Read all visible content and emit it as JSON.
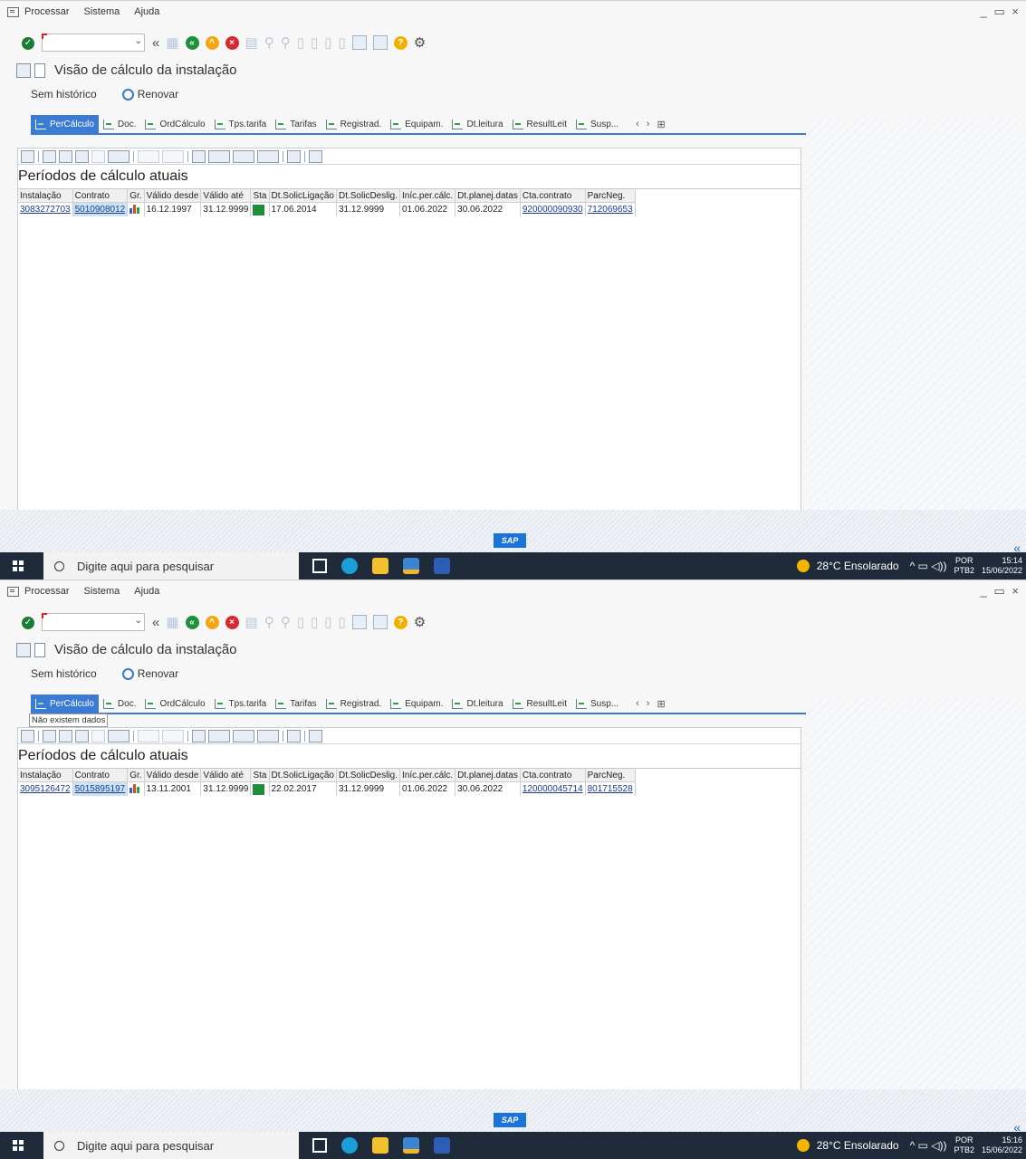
{
  "menu": {
    "processar": "Processar",
    "sistema": "Sistema",
    "ajuda": "Ajuda"
  },
  "window_controls": "_ ▭ ×",
  "title": "Visão de cálculo da instalação",
  "app_toolbar": {
    "sem_historico": "Sem histórico",
    "renovar": "Renovar"
  },
  "tabs": [
    "PerCálculo",
    "Doc.",
    "OrdCálculo",
    "Tps.tarifa",
    "Tarifas",
    "Registrad.",
    "Equipam.",
    "Dt.leitura",
    "ResultLeit",
    "Susp..."
  ],
  "tab_nav": {
    "prev": "‹",
    "next": "›",
    "list": "⊞"
  },
  "panel_title": "Períodos de cálculo atuais",
  "columns": [
    "Instalação",
    "Contrato",
    "Gr.",
    "Válido desde",
    "Válido até",
    "Sta",
    "Dt.SolicLigação",
    "Dt.SolicDeslig.",
    "Iníc.per.cálc.",
    "Dt.planej.datas",
    "Cta.contrato",
    "ParcNeg."
  ],
  "screens": [
    {
      "row": {
        "instalacao": "3083272703",
        "contrato": "5010908012",
        "valido_desde": "16.12.1997",
        "valido_ate": "31.12.9999",
        "dt_lig": "17.06.2014",
        "dt_deslig": "31.12.9999",
        "inic": "01.06.2022",
        "dt_planej": "30.06.2022",
        "cta_contrato": "920000090930",
        "parcneg": "712069653"
      },
      "clock": {
        "time": "15:14",
        "date": "15/06/2022"
      },
      "tooltip": ""
    },
    {
      "row": {
        "instalacao": "3095126472",
        "contrato": "5015895197",
        "valido_desde": "13.11.2001",
        "valido_ate": "31.12.9999",
        "dt_lig": "22.02.2017",
        "dt_deslig": "31.12.9999",
        "inic": "01.06.2022",
        "dt_planej": "30.06.2022",
        "cta_contrato": "120000045714",
        "parcneg": "801715528"
      },
      "clock": {
        "time": "15:16",
        "date": "15/06/2022"
      },
      "tooltip": "Não existem dados"
    }
  ],
  "sap_logo": "SAP",
  "collapse": "«",
  "taskbar": {
    "search_placeholder": "Digite aqui para pesquisar",
    "weather": "28°C  Ensolarado",
    "tray_symbols": "^ ▭ ◁))",
    "lang1": "POR",
    "lang2": "PTB2"
  },
  "colors": {
    "accent": "#3b7bd4",
    "taskbar": "#1f2b3b",
    "status_green": "#1f8f3c"
  }
}
